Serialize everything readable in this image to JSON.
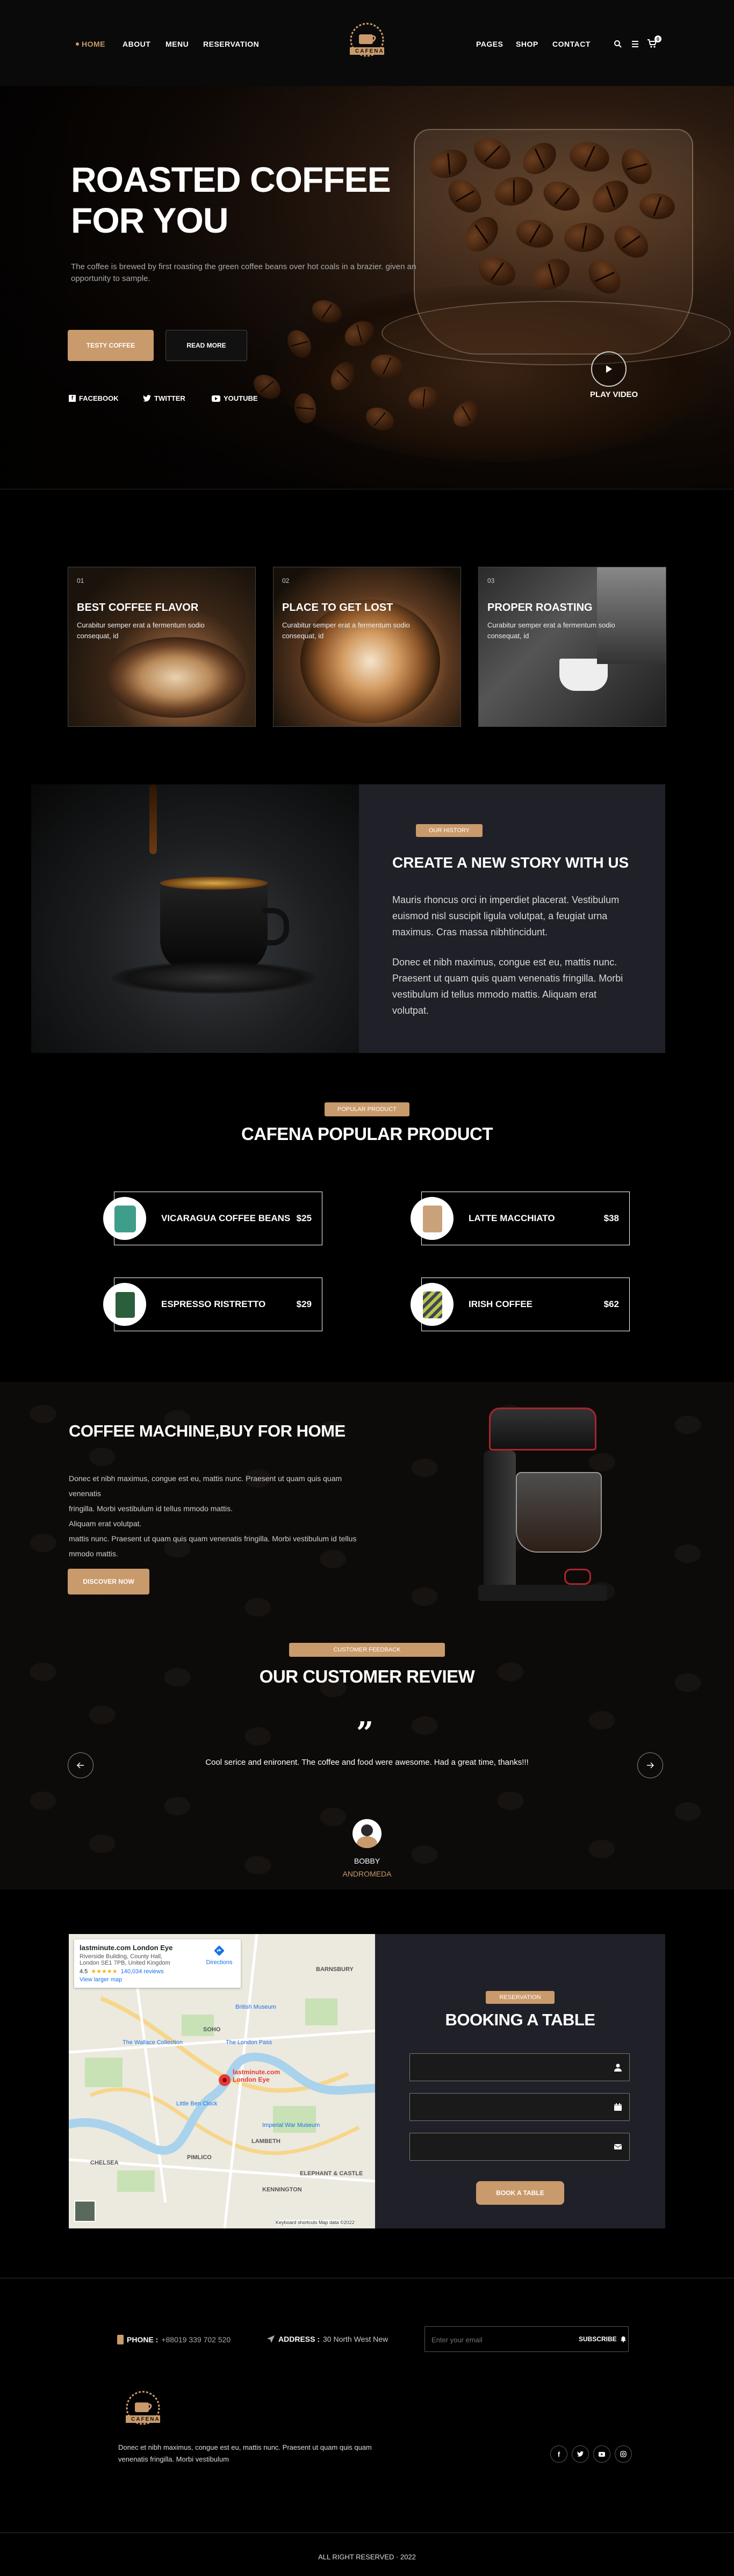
{
  "header": {
    "nav_left": [
      "HOME",
      "ABOUT",
      "MENU",
      "RESERVATION"
    ],
    "nav_right": [
      "PAGES",
      "SHOP",
      "CONTACT"
    ],
    "logo_text": "CAFENA",
    "cart_count": "0"
  },
  "hero": {
    "title_line1": "ROASTED COFFEE",
    "title_line2": "FOR YOU",
    "description": "The coffee is brewed by first roasting the green coffee beans over hot coals in a brazier. given an opportunity to sample.",
    "primary_button": "TESTY COFFEE",
    "secondary_button": "READ MORE",
    "social": [
      "FACEBOOK",
      "TWITTER",
      "YOUTUBE"
    ],
    "play_label": "PLAY VIDEO"
  },
  "features": [
    {
      "num": "01",
      "title": "BEST COFFEE FLAVOR",
      "desc": "Curabitur semper erat a fermentum sodio consequat, id"
    },
    {
      "num": "02",
      "title": "PLACE TO GET LOST",
      "desc": "Curabitur semper erat a fermentum sodio consequat, id"
    },
    {
      "num": "03",
      "title": "PROPER ROASTING",
      "desc": "Curabitur semper erat a fermentum sodio consequat, id"
    }
  ],
  "story": {
    "tag": "OUR HISTORY",
    "title": "CREATE A NEW STORY WITH US",
    "para1": "Mauris rhoncus orci in imperdiet placerat. Vestibulum euismod nisl suscipit ligula volutpat, a feugiat urna maximus. Cras massa nibhtincidunt.",
    "para2": "Donec et nibh maximus, congue est eu, mattis nunc. Praesent ut quam quis quam venenatis fringilla. Morbi vestibulum id tellus mmodo mattis. Aliquam erat volutpat."
  },
  "products": {
    "tag": "POPULAR PRODUCT",
    "title": "CAFENA POPULAR PRODUCT",
    "items": [
      {
        "name": "VICARAGUA COFFEE BEANS",
        "price": "$25"
      },
      {
        "name": "LATTE MACCHIATO",
        "price": "$38"
      },
      {
        "name": "ESPRESSO RISTRETTO",
        "price": "$29"
      },
      {
        "name": "IRISH COFFEE",
        "price": "$62"
      }
    ]
  },
  "machine": {
    "title": "COFFEE MACHINE,BUY FOR HOME",
    "text_lines": [
      "Donec et nibh maximus, congue est eu, mattis nunc. Praesent ut quam quis quam venenatis",
      "fringilla. Morbi vestibulum id tellus mmodo mattis.",
      "Aliquam erat volutpat.",
      "mattis nunc. Praesent ut quam quis quam venenatis fringilla. Morbi vestibulum id tellus",
      "mmodo mattis."
    ],
    "button": "DISCOVER NOW"
  },
  "review": {
    "tag": "CUSTOMER FEEDBACK",
    "title": "OUR CUSTOMER REVIEW",
    "quote": "Cool serice and enironent. The coffee and food were awesome. Had a great time, thanks!!!",
    "name": "BOBBY",
    "company": "ANDROMEDA"
  },
  "map": {
    "place_name": "lastminute.com London Eye",
    "address_line1": "Riverside Building, County Hall,",
    "address_line2": "London SE1 7PB, United Kingdom",
    "rating": "4.5",
    "reviews": "140,034 reviews",
    "larger_map": "View larger map",
    "directions": "Directions",
    "pin_label": "lastminute.com London Eye",
    "labels": [
      "SOHO",
      "The London Pass",
      "LAMBETH",
      "PIMLICO",
      "CHELSEA",
      "The Wallace Collection",
      "Little Ben Clock",
      "British Museum",
      "BARNSBURY",
      "ELEPHANT & CASTLE",
      "KENNINGTON",
      "Imperial War Museum"
    ],
    "footer_text": "Keyboard shortcuts   Map data ©2022"
  },
  "booking": {
    "tag": "RESERVATION",
    "title": "BOOKING A TABLE",
    "button": "BOOK A TABLE"
  },
  "footer": {
    "phone_label": "PHONE :",
    "phone_value": "+88019 339 702 520",
    "address_label": "ADDRESS :",
    "address_value": "30 North West New",
    "email_placeholder": "Enter your email",
    "subscribe": "SUBSCRIBE",
    "logo_text": "CAFENA",
    "about_line1": "Donec et nibh maximus, congue est eu, mattis nunc. Praesent ut quam quis quam",
    "about_line2": "venenatis fringilla. Morbi vestibulum",
    "copyright": "ALL RIGHT RESERVED · 2022"
  }
}
